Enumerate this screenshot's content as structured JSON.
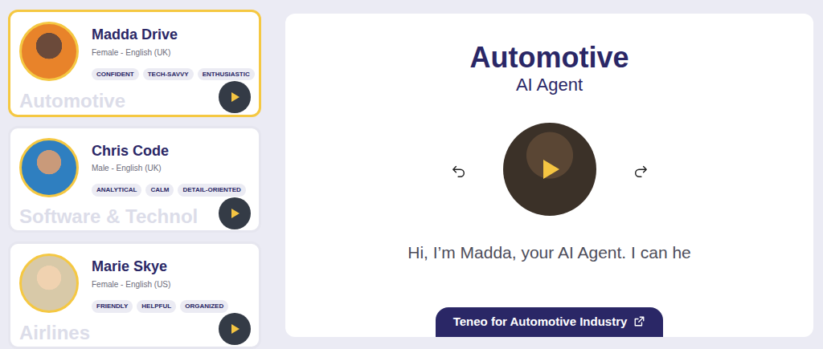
{
  "agents": [
    {
      "name": "Madda Drive",
      "voice": "Female - English (UK)",
      "traits": [
        "CONFIDENT",
        "TECH-SAVVY",
        "ENTHUSIASTIC"
      ],
      "industry": "Automotive",
      "selected": true
    },
    {
      "name": "Chris Code",
      "voice": "Male - English (UK)",
      "traits": [
        "ANALYTICAL",
        "CALM",
        "DETAIL-ORIENTED"
      ],
      "industry": "Software & Technol",
      "selected": false
    },
    {
      "name": "Marie Skye",
      "voice": "Female - English (US)",
      "traits": [
        "FRIENDLY",
        "HELPFUL",
        "ORGANIZED"
      ],
      "industry": "Airlines",
      "selected": false
    }
  ],
  "showcase": {
    "title": "Automotive",
    "subtitle": "AI Agent",
    "greeting": "Hi, I’m Madda, your AI Agent. I can he",
    "link": "Teneo for Automotive Industry"
  }
}
